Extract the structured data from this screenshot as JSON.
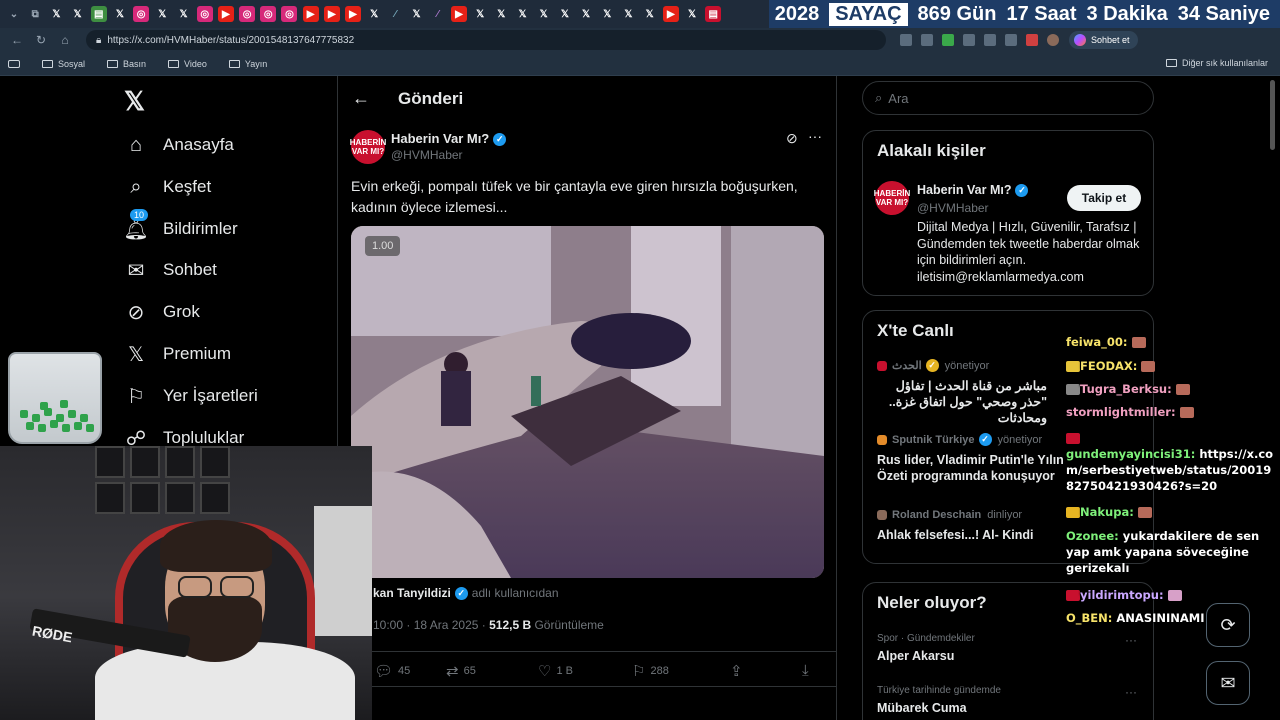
{
  "browser": {
    "url": "https://x.com/HVMHaber/status/2001548137647775832",
    "sohbet_label": "Sohbet et",
    "bookmarks": [
      "Sosyal",
      "Basın",
      "Video",
      "Yayın"
    ],
    "other_bookmarks": "Diğer sık kullanılanlar"
  },
  "counter": {
    "year": "2028",
    "label": "SAYAÇ",
    "days": "869 Gün",
    "hours": "17 Saat",
    "minutes": "3 Dakika",
    "seconds": "34 Saniye"
  },
  "nav": {
    "items": [
      {
        "label": "Anasayfa",
        "icon": "home-icon"
      },
      {
        "label": "Keşfet",
        "icon": "search-icon"
      },
      {
        "label": "Bildirimler",
        "icon": "bell-icon",
        "badge": "10"
      },
      {
        "label": "Sohbet",
        "icon": "mail-icon"
      },
      {
        "label": "Grok",
        "icon": "grok-icon"
      },
      {
        "label": "Premium",
        "icon": "x-icon"
      },
      {
        "label": "Yer İşaretleri",
        "icon": "bookmark-icon"
      },
      {
        "label": "Topluluklar",
        "icon": "communities-icon"
      }
    ]
  },
  "post": {
    "header_title": "Gönderi",
    "avatar_text": "HABERİN VAR MI?",
    "author_name": "Haberin Var Mı?",
    "author_handle": "@HVMHaber",
    "text": "Evin erkeği, pompalı tüfek ve bir çantayla eve giren hırsızla boğuşurken, kadının öylece izlemesi...",
    "video_speed": "1.00",
    "source_name": "kan Tanyildizi",
    "source_suffix": "adlı kullanıcıdan",
    "time": "10:00 · 18 Ara 2025 ·",
    "views": "512,5 B",
    "views_label": "Görüntüleme",
    "replies": "45",
    "reposts": "65",
    "likes": "1 B",
    "bookmarks": "288"
  },
  "right": {
    "search_placeholder": "Ara",
    "related_title": "Alakalı kişiler",
    "related_name": "Haberin Var Mı?",
    "related_handle": "@HVMHaber",
    "follow_label": "Takip et",
    "related_bio": "Dijital Medya | Hızlı, Güvenilir, Tarafsız | Gündemden tek tweetle haberdar olmak için bildirimleri açın. iletisim@reklamlarmedya.com",
    "live_title": "X'te Canlı",
    "live": [
      {
        "name": "الحدث",
        "role": "yönetiyor",
        "title": "مباشر من قناة الحدث | تفاؤل \"حذر وصحي\" حول اتفاق غزة.. ومحادثات"
      },
      {
        "name": "Sputnik Türkiye",
        "role": "yönetiyor",
        "title": "Rus lider, Vladimir Putin'le Yılın Özeti programında konuşuyor"
      },
      {
        "name": "Roland Deschain",
        "role": "dinliyor",
        "title": "Ahlak felsefesi...! Al- Kindi"
      }
    ],
    "trends_title": "Neler oluyor?",
    "trends": [
      {
        "sub": "Spor · Gündemdekiler",
        "name": "Alper Akarsu"
      },
      {
        "sub": "Türkiye tarihinde gündemde",
        "name": "Mübarek Cuma"
      }
    ]
  },
  "chat": [
    {
      "user": "feiwa_00:",
      "msg": ""
    },
    {
      "user": "FEODAX:",
      "msg": ""
    },
    {
      "user": "Tugra_Berksu:",
      "msg": ""
    },
    {
      "user": "stormlightmiller:",
      "msg": ""
    },
    {
      "user": "gundemyayincisi31:",
      "msg": "https://x.com/serbestiyetweb/status/2001982750421930426?s=20"
    },
    {
      "user": "Nakupa:",
      "msg": ""
    },
    {
      "user": "Ozonee:",
      "msg": "yukardakilere de sen yap amk yapana söveceğine gerizekalı"
    },
    {
      "user": "yildirimtopu:",
      "msg": ""
    },
    {
      "user": "O_BEN:",
      "msg": "ANASININAMI kedi"
    }
  ]
}
